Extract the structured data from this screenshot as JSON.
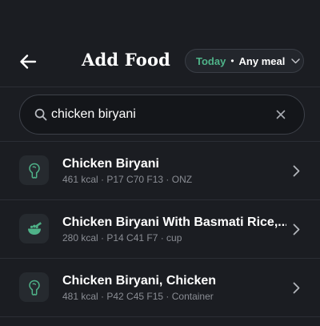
{
  "header": {
    "title": "Add Food",
    "back_icon": "arrow-left-icon",
    "meal_selector": {
      "date": "Today",
      "separator": "•",
      "meal": "Any meal",
      "chevron_icon": "chevron-down-icon"
    }
  },
  "search": {
    "value": "chicken biryani",
    "placeholder": "",
    "search_icon": "search-icon",
    "clear_icon": "close-icon"
  },
  "results": [
    {
      "name": "Chicken Biryani",
      "meta": "461 kcal · P17 C70 F13 · ONZ",
      "icon": "drumstick-icon"
    },
    {
      "name": "Chicken Biryani With Basmati Rice,...",
      "meta": "280 kcal · P14 C41 F7 · cup",
      "icon": "bowl-icon"
    },
    {
      "name": "Chicken Biryani, Chicken",
      "meta": "481 kcal · P42 C45 F15 · Container",
      "icon": "drumstick-icon"
    }
  ],
  "colors": {
    "background": "#1b1d22",
    "accent": "#4fb389",
    "muted_text": "#8a8d94",
    "divider": "#2b2e35"
  }
}
